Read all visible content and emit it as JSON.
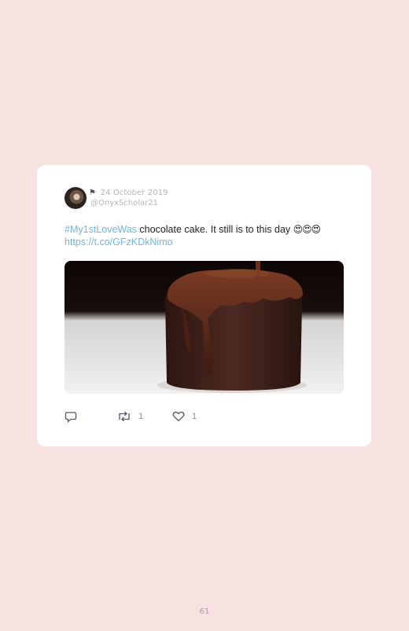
{
  "tweet": {
    "date": "24 October 2019",
    "handle": "@OnyxScholar21",
    "hashtag": "#My1stLoveWas",
    "text": " chocolate cake. It still is to this day ",
    "emoji": "😍😍😍",
    "link": "https://t.co/GFzKDkNimo",
    "media": {
      "description_icon": "chocolate-lava-cake-photo"
    },
    "actions": {
      "reply_icon": "reply-icon",
      "retweet_icon": "retweet-icon",
      "retweet_count": "1",
      "like_icon": "heart-icon",
      "like_count": "1"
    }
  },
  "page": {
    "number": "61"
  },
  "colors": {
    "background": "#f7e1e1",
    "card": "#ffffff",
    "link": "#6fb7e0"
  }
}
